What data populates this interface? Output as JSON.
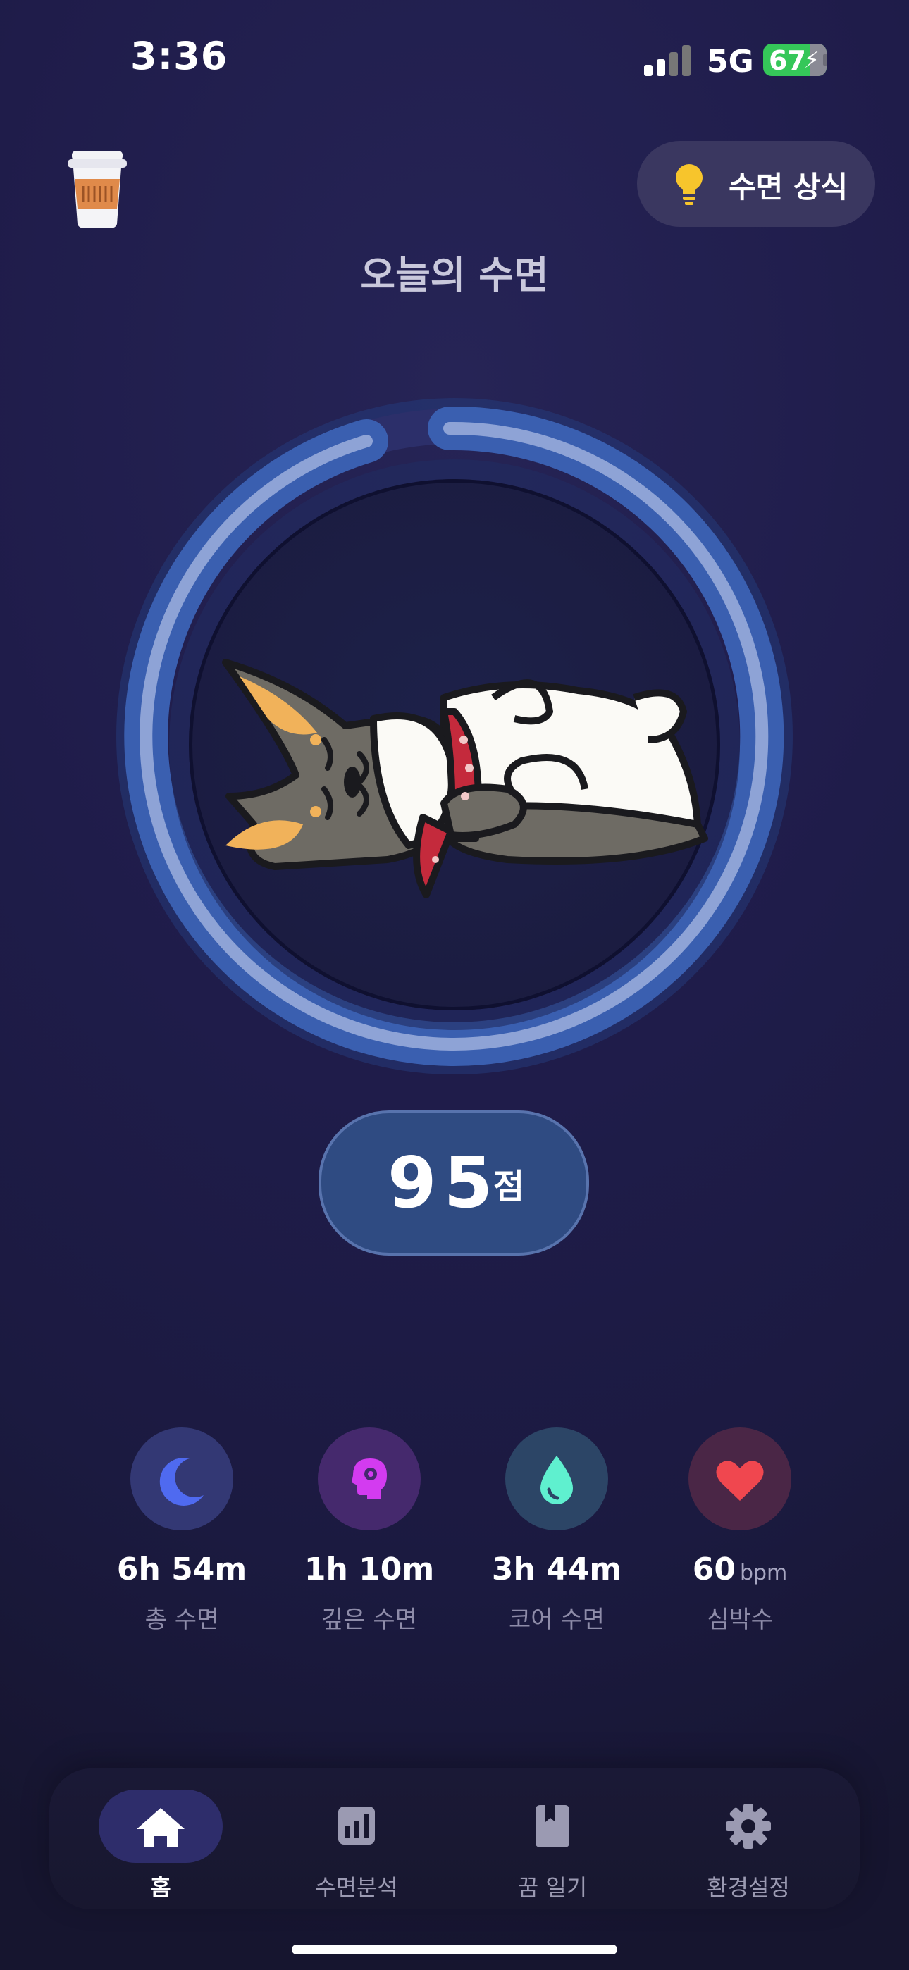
{
  "status_bar": {
    "time": "3:36",
    "network": "5G",
    "battery": "67",
    "battery_level": 0.67
  },
  "header": {
    "tips_label": "수면 상식",
    "title": "오늘의 수면"
  },
  "ring": {
    "progress_ring_gap": true
  },
  "score": {
    "value": "95",
    "unit": "점"
  },
  "stats": [
    {
      "value": "6h 54m",
      "unit": "",
      "label": "총 수면",
      "icon": "moon-icon",
      "icon_color": "#4f6af0",
      "bg": "#333874"
    },
    {
      "value": "1h 10m",
      "unit": "",
      "label": "깊은 수면",
      "icon": "brain-icon",
      "icon_color": "#d33bf0",
      "bg": "#45296d"
    },
    {
      "value": "3h 44m",
      "unit": "",
      "label": "코어 수면",
      "icon": "drop-icon",
      "icon_color": "#5ff0cf",
      "bg": "#2c4566"
    },
    {
      "value": "60",
      "unit": "bpm",
      "label": "심박수",
      "icon": "heart-icon",
      "icon_color": "#f0474f",
      "bg": "#4a2646"
    }
  ],
  "tabs": [
    {
      "label": "홈",
      "icon": "home-icon",
      "active": true
    },
    {
      "label": "수면분석",
      "icon": "chart-icon",
      "active": false
    },
    {
      "label": "꿈 일기",
      "icon": "book-icon",
      "active": false
    },
    {
      "label": "환경설정",
      "icon": "gear-icon",
      "active": false
    }
  ],
  "colors": {
    "accent": "#2f4b82",
    "ring": "#8ea3d6",
    "tab_active": "#2e2d6b"
  }
}
